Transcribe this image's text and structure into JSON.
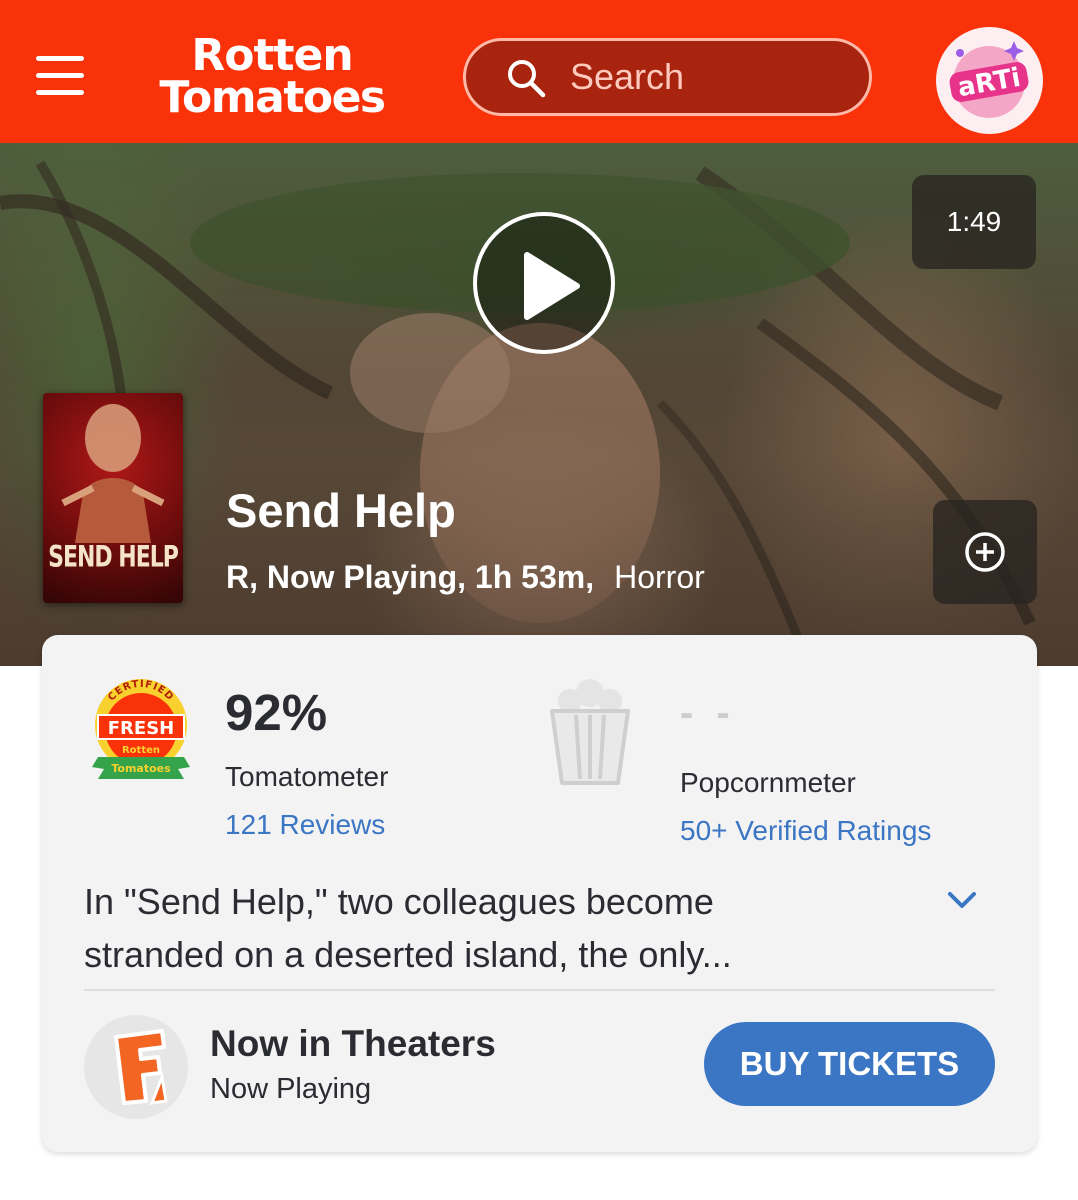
{
  "header": {
    "logo_line1": "Rotten",
    "logo_line2": "Tomatoes",
    "search_placeholder": "Search",
    "avatar_text": "aRTi",
    "brand_color": "#fa320a"
  },
  "hero": {
    "video_duration": "1:49",
    "poster_title": "SEND HELP",
    "movie_title": "Send Help",
    "meta_primary": "R, Now Playing, 1h 53m,",
    "genre": "Horror"
  },
  "scores": {
    "badge_top": "CERTIFIED",
    "badge_main": "FRESH",
    "badge_line1": "Rotten",
    "badge_line2": "Tomatoes",
    "tomatometer_value": "92%",
    "tomatometer_label": "Tomatometer",
    "reviews_link": "121 Reviews",
    "popcornmeter_value": "- -",
    "popcornmeter_label": "Popcornmeter",
    "ratings_link": "50+ Verified Ratings"
  },
  "synopsis": {
    "text": "In \"Send Help,\" two colleagues become stranded on a deserted island, the only..."
  },
  "theaters": {
    "title": "Now in Theaters",
    "subtitle": "Now Playing",
    "button_label": "BUY TICKETS",
    "accent_color": "#3a76c4"
  }
}
